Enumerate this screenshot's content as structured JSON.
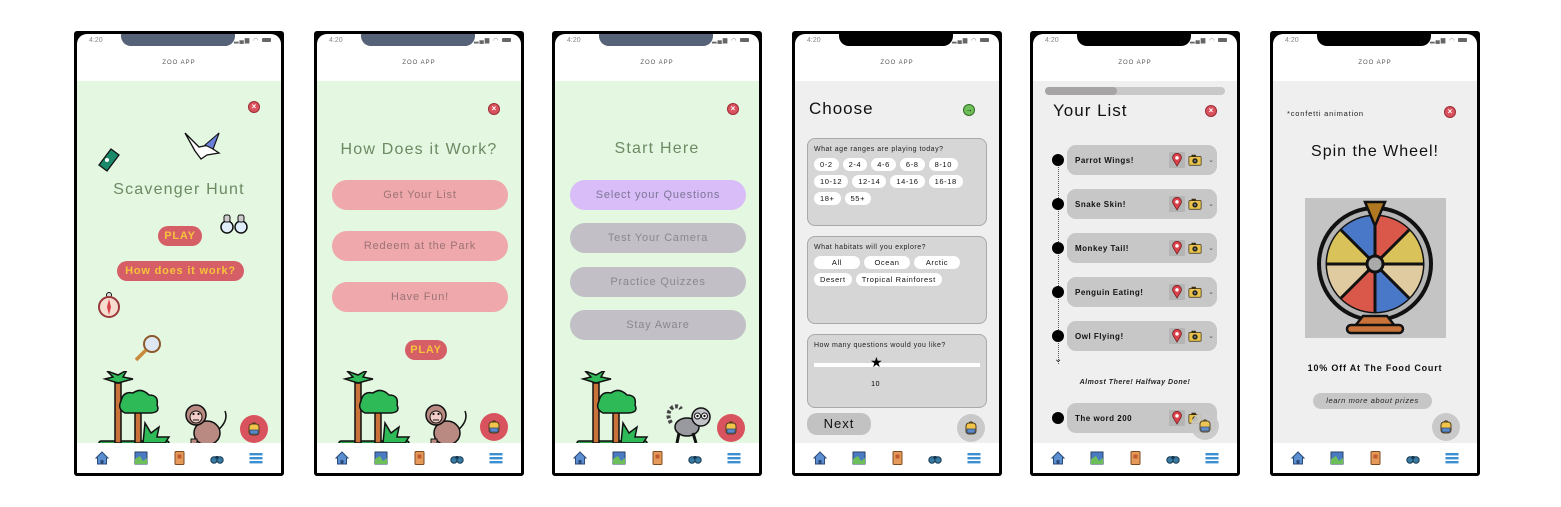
{
  "common": {
    "status_time": "4:20",
    "app_title": "ZOO APP",
    "nav": [
      {
        "name": "home",
        "icon": "home-icon"
      },
      {
        "name": "map",
        "icon": "map-icon"
      },
      {
        "name": "guide",
        "icon": "book-icon"
      },
      {
        "name": "explore",
        "icon": "binoculars-icon"
      },
      {
        "name": "menu",
        "icon": "menu-icon"
      }
    ]
  },
  "screens": [
    {
      "id": "scavenger-hunt",
      "title": "Scavenger Hunt",
      "play_label": "PLAY",
      "how_label": "How does it work?"
    },
    {
      "id": "how-it-works",
      "title": "How Does it Work?",
      "steps": [
        "Get Your List",
        "Redeem at the Park",
        "Have Fun!"
      ],
      "play_label": "PLAY"
    },
    {
      "id": "start-here",
      "title": "Start Here",
      "options": [
        {
          "label": "Select your Questions",
          "state": "active"
        },
        {
          "label": "Test Your Camera",
          "state": "disabled"
        },
        {
          "label": "Practice Quizzes",
          "state": "disabled"
        },
        {
          "label": "Stay Aware",
          "state": "disabled"
        }
      ]
    },
    {
      "id": "choose",
      "title": "Choose",
      "age_question": "What age ranges are playing today?",
      "age_ranges": [
        "0-2",
        "2-4",
        "4-6",
        "6-8",
        "8-10",
        "10-12",
        "12-14",
        "14-16",
        "16-18",
        "18+",
        "55+"
      ],
      "habitat_question": "What habitats will you explore?",
      "habitats": [
        "All",
        "Ocean",
        "Arctic",
        "Desert",
        "Tropical Rainforest"
      ],
      "count_question": "How many questions would you like?",
      "count_value": "10",
      "count_fraction": 0.38,
      "next_label": "Next"
    },
    {
      "id": "your-list",
      "title": "Your List",
      "progress": 0.4,
      "items": [
        "Parrot Wings!",
        "Snake Skin!",
        "Monkey Tail!",
        "Penguin Eating!",
        "Owl Flying!"
      ],
      "milestone": "Almost There! Halfway Done!",
      "last_item": "The word 200"
    },
    {
      "id": "spin-wheel",
      "note": "*confetti animation",
      "title": "Spin the Wheel!",
      "prize": "10% Off At The Food Court",
      "learn_more_label": "learn more about prizes"
    }
  ],
  "colors": {
    "mint_bg": "#e3f7e1",
    "grey_bg": "#efefef",
    "accent_red": "#d65f67",
    "accent_yellow": "#f5c33b",
    "title_green": "#6d8a63",
    "pink_button": "#efa8ab",
    "purple_button": "#d8bdf8"
  }
}
